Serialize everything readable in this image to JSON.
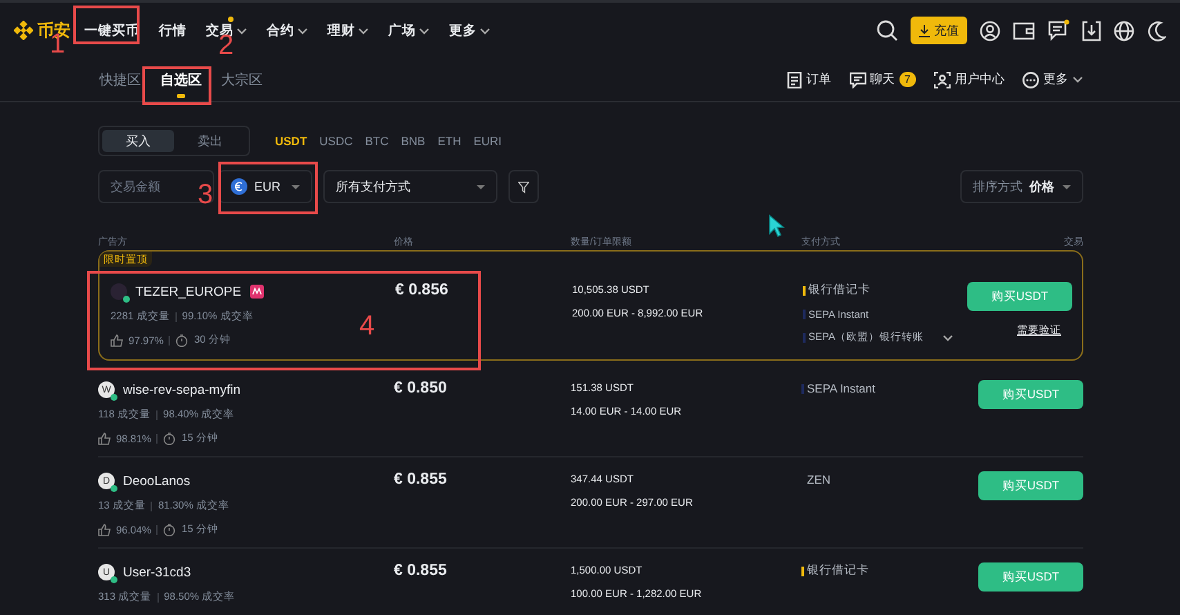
{
  "header": {
    "logo": "币安",
    "nav": [
      {
        "label": "一键买币",
        "dropdown": false,
        "dot": false
      },
      {
        "label": "行情",
        "dropdown": false,
        "dot": false
      },
      {
        "label": "交易",
        "dropdown": true,
        "dot": true
      },
      {
        "label": "合约",
        "dropdown": true,
        "dot": false
      },
      {
        "label": "理财",
        "dropdown": true,
        "dot": false
      },
      {
        "label": "广场",
        "dropdown": true,
        "dot": false
      },
      {
        "label": "更多",
        "dropdown": true,
        "dot": false
      }
    ],
    "deposit_button": "充值"
  },
  "subnav": {
    "tabs": [
      {
        "label": "快捷区",
        "selected": false
      },
      {
        "label": "自选区",
        "selected": true
      },
      {
        "label": "大宗区",
        "selected": false
      }
    ],
    "links": [
      {
        "kind": "orders",
        "label": "订单"
      },
      {
        "kind": "chat",
        "label": "聊天",
        "badge": "7"
      },
      {
        "kind": "user",
        "label": "用户中心"
      },
      {
        "kind": "more",
        "label": "更多"
      }
    ]
  },
  "trade_side": [
    {
      "label": "买入",
      "selected": true
    },
    {
      "label": "卖出",
      "selected": false
    }
  ],
  "assets": [
    {
      "label": "USDT",
      "selected": true
    },
    {
      "label": "USDC",
      "selected": false
    },
    {
      "label": "BTC",
      "selected": false
    },
    {
      "label": "BNB",
      "selected": false
    },
    {
      "label": "ETH",
      "selected": false
    },
    {
      "label": "EURI",
      "selected": false
    }
  ],
  "filters": {
    "amount_placeholder": "交易金额",
    "currency": "EUR",
    "payment": "所有支付方式",
    "sort_label": "排序方式",
    "sort_value": "价格"
  },
  "table": {
    "columns": [
      "广告方",
      "价格",
      "数量/订单限额",
      "支付方式",
      "交易"
    ],
    "rows": [
      {
        "promoted": true,
        "promo_label": "限时置顶",
        "name": "TEZER_EUROPE",
        "merchant_badge": true,
        "online": true,
        "trades": "2281 成交量",
        "completion": "99.10% 成交率",
        "rating": "97.97%",
        "time": "30 分钟",
        "price": "€ 0.856",
        "quantity": "10,505.38 USDT",
        "limits": "200.00 EUR - 8,992.00 EUR",
        "payments": [
          {
            "label": "银行借记卡",
            "color": "#f0b90b"
          },
          {
            "label": "SEPA Instant",
            "color": "#1e2a5e"
          },
          {
            "label": "SEPA（欧盟）银行转账",
            "color": "#1e2a5e"
          }
        ],
        "payments_expandable": true,
        "button": "购买USDT",
        "note": "需要验证"
      },
      {
        "promoted": false,
        "avatar": "W",
        "name": "wise-rev-sepa-myfin",
        "merchant_badge": false,
        "online": true,
        "trades": "118 成交量",
        "completion": "98.40% 成交率",
        "rating": "98.81%",
        "time": "15 分钟",
        "price": "€ 0.850",
        "quantity": "151.38 USDT",
        "limits": "14.00 EUR - 14.00 EUR",
        "payments": [
          {
            "label": "SEPA Instant",
            "color": "#1e2a5e"
          }
        ],
        "payments_expandable": false,
        "button": "购买USDT"
      },
      {
        "promoted": false,
        "avatar": "D",
        "name": "DeooLanos",
        "merchant_badge": false,
        "online": true,
        "trades": "13 成交量",
        "completion": "81.30% 成交率",
        "rating": "96.04%",
        "time": "15 分钟",
        "price": "€ 0.855",
        "quantity": "347.44 USDT",
        "limits": "200.00 EUR - 297.00 EUR",
        "payments": [
          {
            "label": "ZEN"
          }
        ],
        "payments_expandable": false,
        "button": "购买USDT"
      },
      {
        "promoted": false,
        "avatar": "U",
        "name": "User-31cd3",
        "merchant_badge": false,
        "online": true,
        "trades": "313 成交量",
        "completion": "98.50% 成交率",
        "price": "€ 0.855",
        "quantity": "1,500.00 USDT",
        "limits": "100.00 EUR - 1,282.00 EUR",
        "payments": [
          {
            "label": "银行借记卡",
            "color": "#f0b90b"
          }
        ],
        "payments_expandable": false,
        "button": "购买USDT"
      }
    ]
  },
  "annotations": [
    {
      "label": "1"
    },
    {
      "label": "2"
    },
    {
      "label": "3"
    },
    {
      "label": "4"
    }
  ]
}
